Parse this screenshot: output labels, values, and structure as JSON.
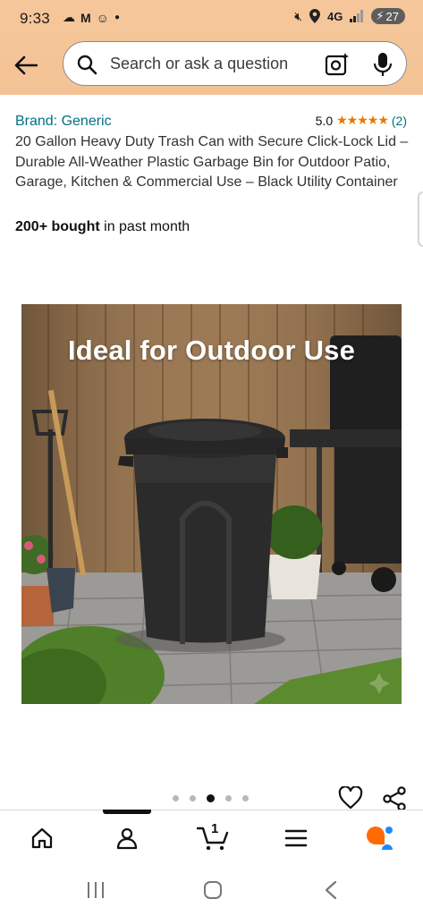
{
  "status_bar": {
    "time": "9:33",
    "network": "4G",
    "battery": "27"
  },
  "search": {
    "placeholder": "Search or ask a question"
  },
  "product": {
    "brand": "Brand: Generic",
    "rating_value": "5.0",
    "rating_stars": 5,
    "rating_count": "(2)",
    "title": "20 Gallon Heavy Duty Trash Can with Secure Click-Lock Lid – Durable All-Weather Plastic Garbage Bin for Outdoor Patio, Garage, Kitchen & Commercial Use – Black Utility Container",
    "bought_bold": "200+ bought",
    "bought_rest": " in past month",
    "image_overlay_text": "Ideal for Outdoor Use"
  },
  "carousel": {
    "dot_count": 5,
    "active_index": 2
  },
  "bottom_nav": {
    "cart_count": "1",
    "accent_color": "#ff6a00"
  },
  "colors": {
    "header_bg": "#f3c396",
    "link": "#007185",
    "star": "#e67a00"
  }
}
